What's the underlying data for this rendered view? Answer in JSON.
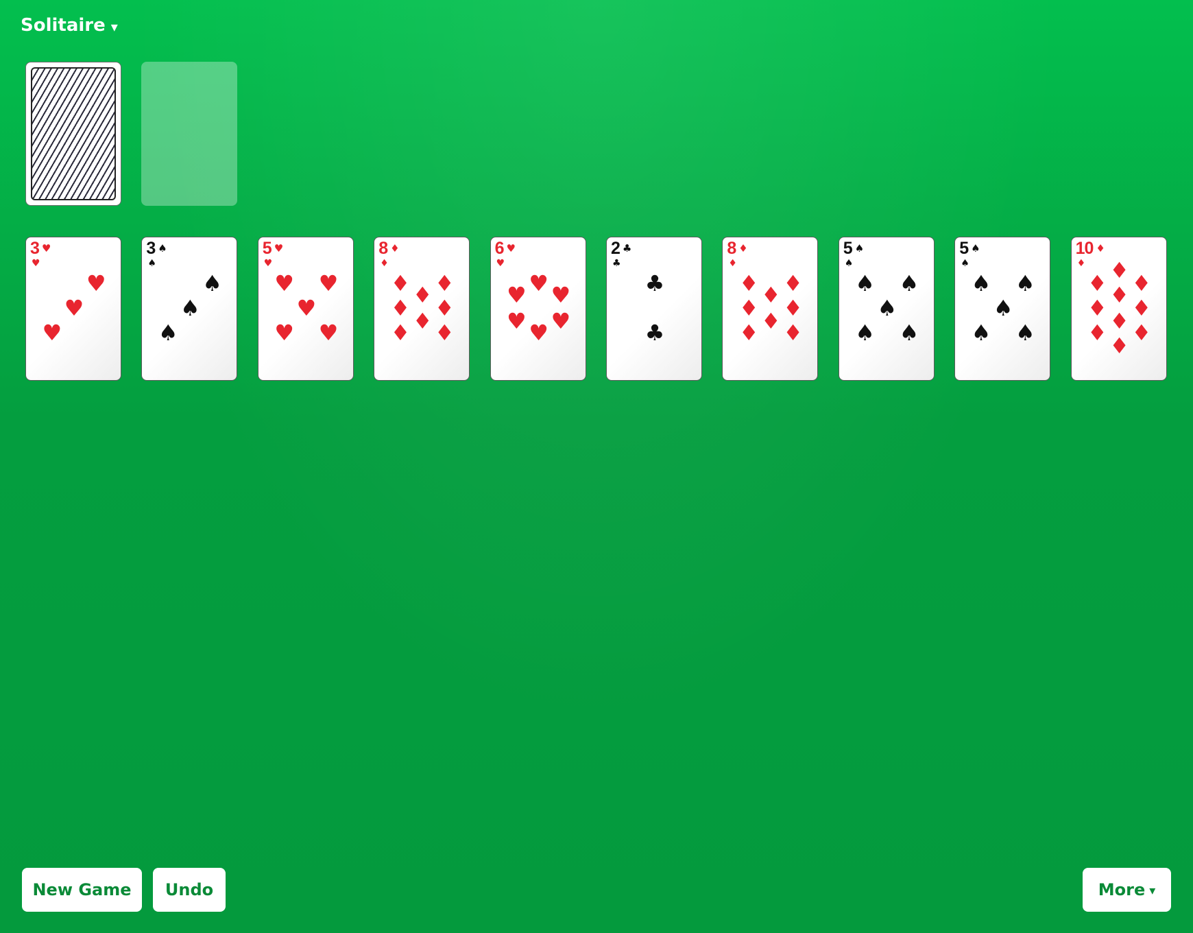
{
  "header": {
    "game_title": "Solitaire",
    "caret": "▾",
    "caret_icon": "chevron-down-icon"
  },
  "stock": {
    "state": "face-down",
    "pattern": "diagonal-stripes"
  },
  "waste": {
    "state": "empty"
  },
  "tableau": [
    {
      "rank": "3",
      "suit": "♥",
      "suit_name": "hearts",
      "color": "red"
    },
    {
      "rank": "3",
      "suit": "♠",
      "suit_name": "spades",
      "color": "black"
    },
    {
      "rank": "5",
      "suit": "♥",
      "suit_name": "hearts",
      "color": "red"
    },
    {
      "rank": "8",
      "suit": "♦",
      "suit_name": "diamonds",
      "color": "red"
    },
    {
      "rank": "6",
      "suit": "♥",
      "suit_name": "hearts",
      "color": "red"
    },
    {
      "rank": "2",
      "suit": "♣",
      "suit_name": "clubs",
      "color": "black"
    },
    {
      "rank": "8",
      "suit": "♦",
      "suit_name": "diamonds",
      "color": "red"
    },
    {
      "rank": "5",
      "suit": "♠",
      "suit_name": "spades",
      "color": "black"
    },
    {
      "rank": "5",
      "suit": "♠",
      "suit_name": "spades",
      "color": "black"
    },
    {
      "rank": "10",
      "suit": "♦",
      "suit_name": "diamonds",
      "color": "red"
    }
  ],
  "buttons": {
    "new_game": "New Game",
    "undo": "Undo",
    "more": "More",
    "more_caret": "▾"
  },
  "colors": {
    "felt_top": "#03bf4e",
    "felt_bottom": "#049a3d",
    "red_suit": "#e8252f",
    "black_suit": "#111111",
    "button_text": "#0a8a37"
  }
}
